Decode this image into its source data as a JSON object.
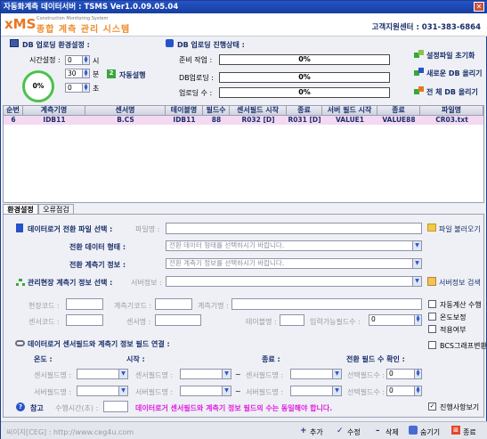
{
  "window": {
    "title": "자동화계측 데이터서버 : TSMS Ver1.0.09.05.04",
    "close": "✕"
  },
  "header": {
    "logo": "xMS",
    "logo_sub": "Construction  Monitoring  System",
    "logo_ko": "종합 계측 관리 시스템",
    "support": "고객지원센터 : 031-383-6864"
  },
  "upload_env": {
    "title": "DB 업로딩 환경설정 :",
    "time_label": "시간설정 :",
    "hour": "0",
    "hour_unit": "시",
    "minute": "30",
    "minute_unit": "분",
    "second": "0",
    "second_unit": "초",
    "auto_label": "자동설행",
    "gauge": "0%"
  },
  "upload_status": {
    "title": "DB 업로딩 진행상태 :",
    "rows": [
      {
        "label": "준비 작업 :",
        "value": "0%"
      },
      {
        "label": "DB업로딩 :",
        "value": "0%"
      },
      {
        "label": "업로딩 수 :",
        "value": "0%"
      }
    ]
  },
  "actions": {
    "reset": "설정파일 초기화",
    "new_upload": "새로운 DB 올리기",
    "all_upload": "전   체 DB 올리기"
  },
  "table": {
    "headers": [
      "순번",
      "계측기명",
      "센서명",
      "테이블명",
      "필드수",
      "센서필드 시작",
      "종료",
      "서버 필드 시작",
      "종료",
      "파일명"
    ],
    "rows": [
      [
        "6",
        "IDB11",
        "B.CS",
        "IDB11",
        "88",
        "R032 [D]",
        "R031 [D]",
        "VALUE1",
        "VALUE88",
        "CR03.txt"
      ]
    ]
  },
  "tabs": [
    {
      "label": "환경설정"
    },
    {
      "label": "오류점검"
    }
  ],
  "settings": {
    "datalogger_title": "데이터로거 전환 파일 선택 :",
    "filename_label": "파일명 :",
    "file_load": "파일 불러오기",
    "conv_type_label": "전환 데이터 형태 :",
    "conv_type_value": "전환 데이터 형태를 선택하시기 바랍니다.",
    "conv_info_label": "전환 계측기 정보 :",
    "conv_info_value": "전환 계측기 정보를 선택하시기 바랍니다.",
    "site_title": "관리현장 계측기 정보 선택 :",
    "server_info_label": "서버정보 :",
    "server_search": "서버정보 검색",
    "site_code": "현장코드 :",
    "meter_code": "계측기코드 :",
    "meter_name": "계측기명 :",
    "sensor_code": "센서코드 :",
    "sensor_name": "센서명 :",
    "table_name": "테이블명 :",
    "input_fields": "입력가능필드수 :",
    "input_fields_value": "0",
    "checks": [
      {
        "label": "자동계산 수행",
        "checked": false
      },
      {
        "label": "온도보정",
        "checked": false
      },
      {
        "label": "적용여부",
        "checked": false
      },
      {
        "label": "BCS그래프변환",
        "checked": false
      }
    ],
    "link_title": "데이터로거 센서필드와 계측기 정보 필드 연결 :",
    "temp_label": "온도 :",
    "start_label": "시작 :",
    "end_label": "종료 :",
    "conv_check_label": "전환 필드 수 확인 :",
    "sensor_field": "센서필드명 :",
    "server_field": "서버필드명 :",
    "select_field": "선택필드수 :",
    "select_value": "0",
    "tilde": "~",
    "ref_label": "참고",
    "exec_time_label": "수행시간(초) :",
    "ref_note": "데이터로거 센서필드와 계측기 정보 필드의 수는 동일해야 합니다.",
    "progress_view": "진행사항보기",
    "progress_view_checked": true
  },
  "statusbar": {
    "site": "씨이지[CEG] : http://www.ceg4u.com",
    "add": "추가",
    "edit": "수정",
    "delete": "삭제",
    "hide": "숨기기",
    "close": "종료"
  },
  "colors": {
    "title_bg": "#2553c9",
    "row_highlight": "#f3d9f2",
    "accent_orange": "#e87722",
    "gauge_green": "#4cc24c",
    "note_magenta": "#e21de0"
  }
}
